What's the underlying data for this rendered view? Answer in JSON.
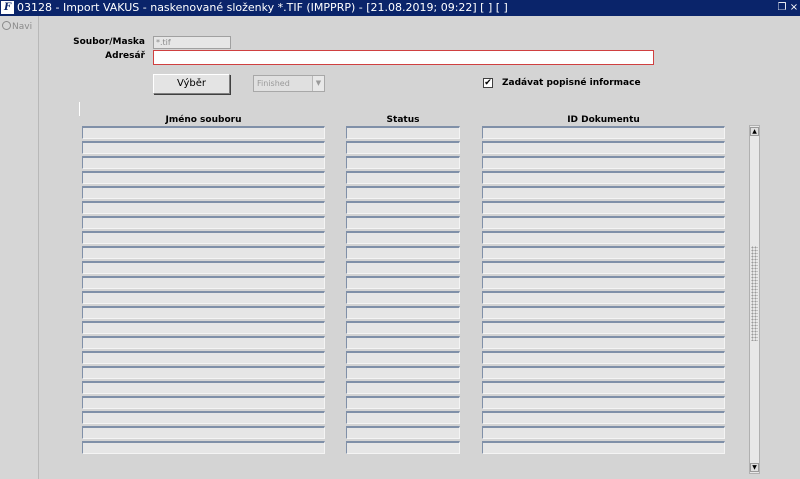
{
  "window": {
    "app_icon": "F",
    "title": "03128 - Import VAKUS - naskenované složenky *.TIF (IMPPRP) - [21.08.2019; 09:22]  [ ]  [ ]",
    "restore_glyph": "❐",
    "close_glyph": "×"
  },
  "navigator": {
    "label": "Navi"
  },
  "form": {
    "mask_label": "Soubor/Maska",
    "mask_value": "*.tif",
    "dir_label": "Adresář",
    "dir_value": "",
    "select_button": "Výběr",
    "status_select": {
      "selected": "Finished",
      "options": [
        "Finished"
      ]
    },
    "checkbox": {
      "label": "Zadávat popisné informace",
      "checked": true,
      "mark": "✔"
    }
  },
  "table": {
    "columns": [
      "Jméno souboru",
      "Status",
      "ID Dokumentu"
    ],
    "row_count": 22,
    "rows": []
  },
  "scrollbar": {
    "up_glyph": "▲",
    "down_glyph": "▼"
  },
  "colors": {
    "titlebar": "#0a246a",
    "background": "#d4d4d4",
    "required_border": "#d04040"
  }
}
